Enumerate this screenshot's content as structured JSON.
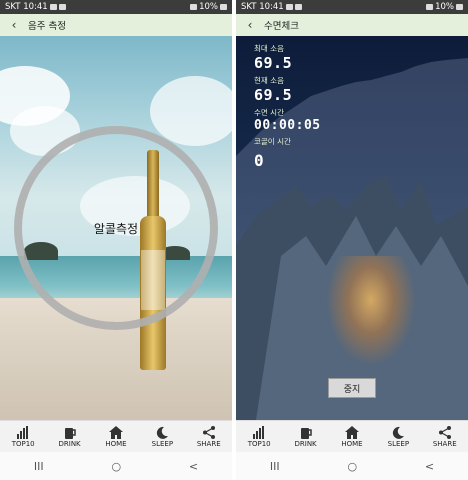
{
  "status_bar": {
    "carrier_time": "SKT 10:41",
    "battery": "10%"
  },
  "left_screen": {
    "app_bar_title": "음주 측정",
    "measure_button_label": "알콜측정"
  },
  "right_screen": {
    "app_bar_title": "수면체크",
    "max_noise_label": "최대 소음",
    "max_noise_value": "69.5",
    "current_noise_label": "현재 소음",
    "current_noise_value": "69.5",
    "sleep_time_label": "수면 시간",
    "sleep_time_value": "00:00:05",
    "snore_time_label": "코골이 시간",
    "snore_time_value": "0",
    "stop_button_label": "중지"
  },
  "tabs": [
    {
      "label": "TOP10",
      "icon": "bar-chart-icon"
    },
    {
      "label": "DRINK",
      "icon": "beer-mug-icon"
    },
    {
      "label": "HOME",
      "icon": "home-icon"
    },
    {
      "label": "SLEEP",
      "icon": "moon-icon"
    },
    {
      "label": "SHARE",
      "icon": "share-icon"
    }
  ],
  "nav_glyphs": {
    "recents": "III",
    "home": "○",
    "back": "<"
  }
}
